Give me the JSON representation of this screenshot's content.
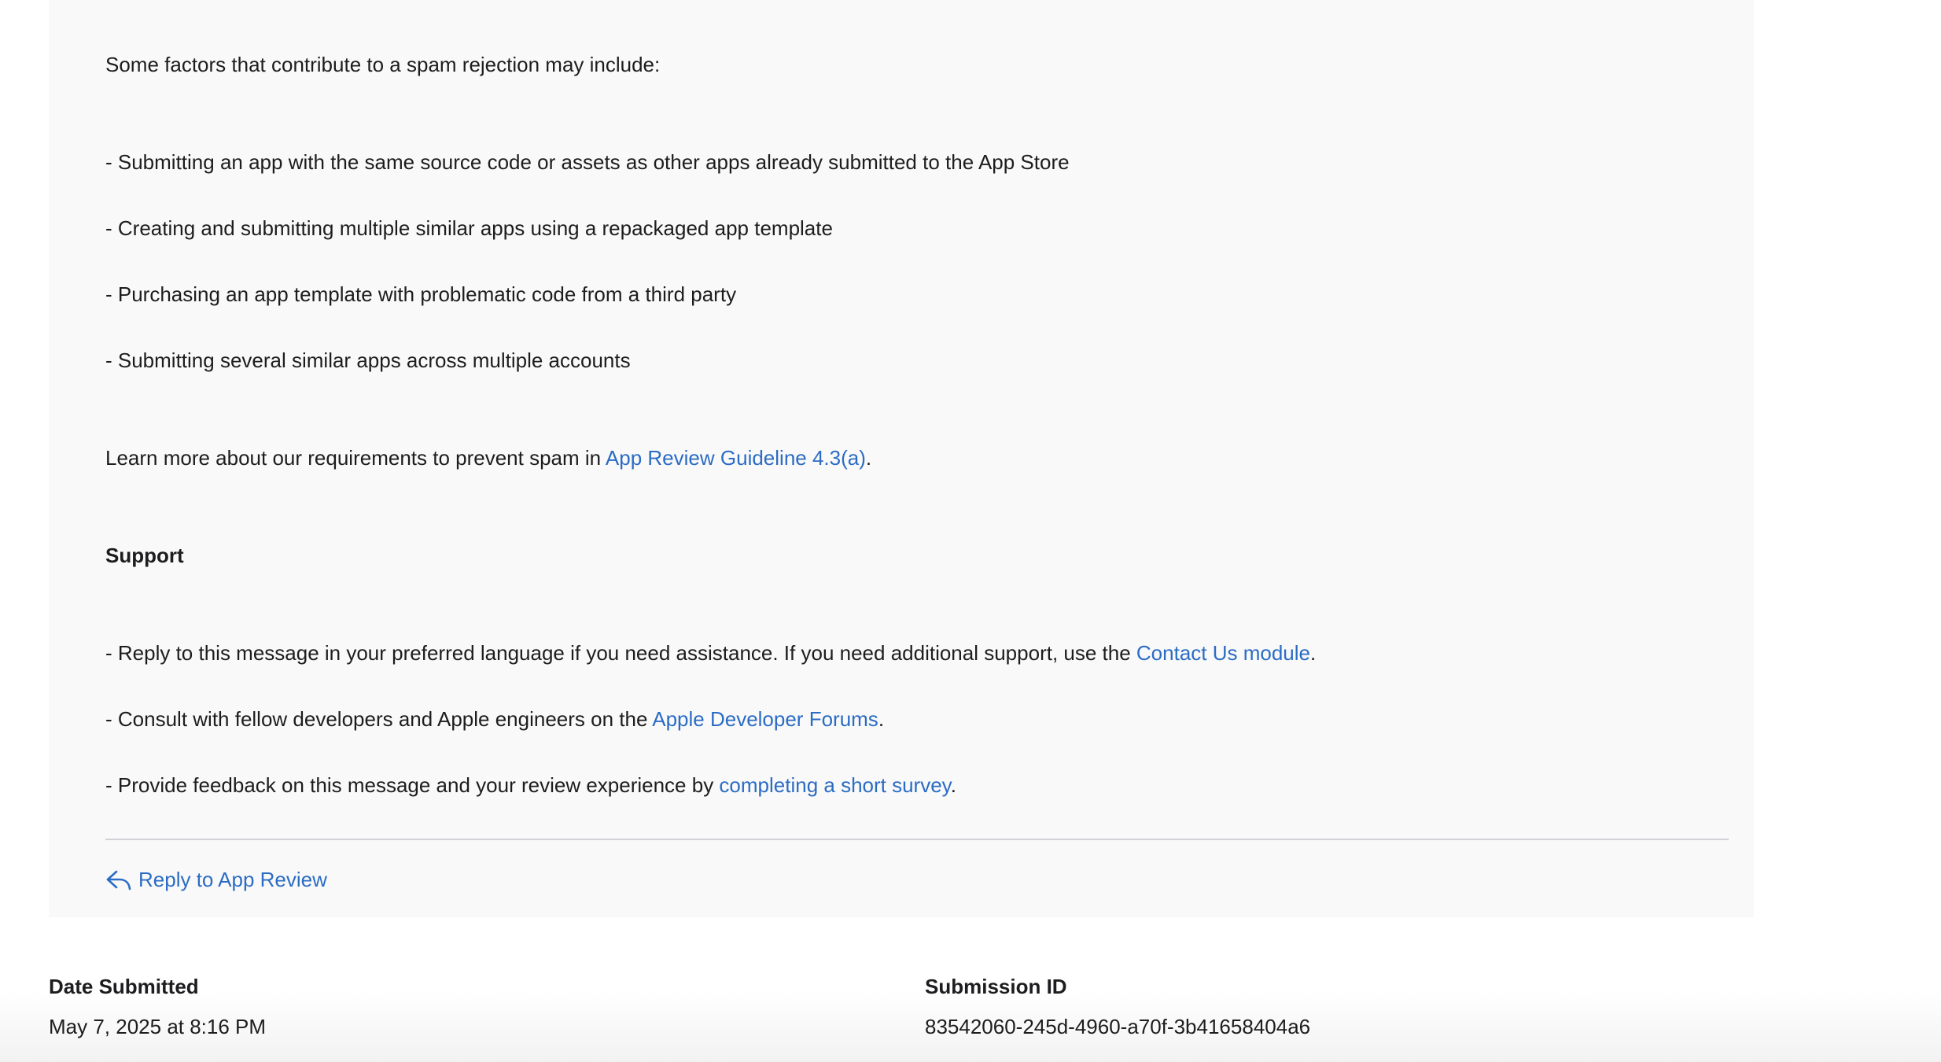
{
  "message": {
    "intro": "Some factors that contribute to a spam rejection may include:",
    "factors": [
      "- Submitting an app with the same source code or assets as other apps already submitted to the App Store",
      "- Creating and submitting multiple similar apps using a repackaged app template",
      "- Purchasing an app template with problematic code from a third party",
      "- Submitting several similar apps across multiple accounts"
    ],
    "learn_more": {
      "prefix": "Learn more about our requirements to prevent spam in ",
      "link": "App Review Guideline 4.3(a)",
      "suffix": "."
    },
    "support_heading": "Support",
    "support_items": [
      {
        "prefix": "- Reply to this message in your preferred language if you need assistance. If you need additional support, use the ",
        "link": "Contact Us module",
        "suffix": "."
      },
      {
        "prefix": "- Consult with fellow developers and Apple engineers on the ",
        "link": "Apple Developer Forums",
        "suffix": "."
      },
      {
        "prefix": "- Provide feedback on this message and your review experience by ",
        "link": "completing a short survey",
        "suffix": "."
      }
    ],
    "reply_label": "Reply to App Review",
    "reply_icon": "reply-arrow-icon"
  },
  "details": {
    "date_submitted_label": "Date Submitted",
    "date_submitted_value": "May 7, 2025 at 8:16 PM",
    "submission_id_label": "Submission ID",
    "submission_id_value": "83542060-245d-4960-a70f-3b41658404a6"
  },
  "colors": {
    "link": "#2b6cc4",
    "text": "#1d1d1f",
    "card_background": "#f9f9f9",
    "divider": "#d2d2d7"
  }
}
